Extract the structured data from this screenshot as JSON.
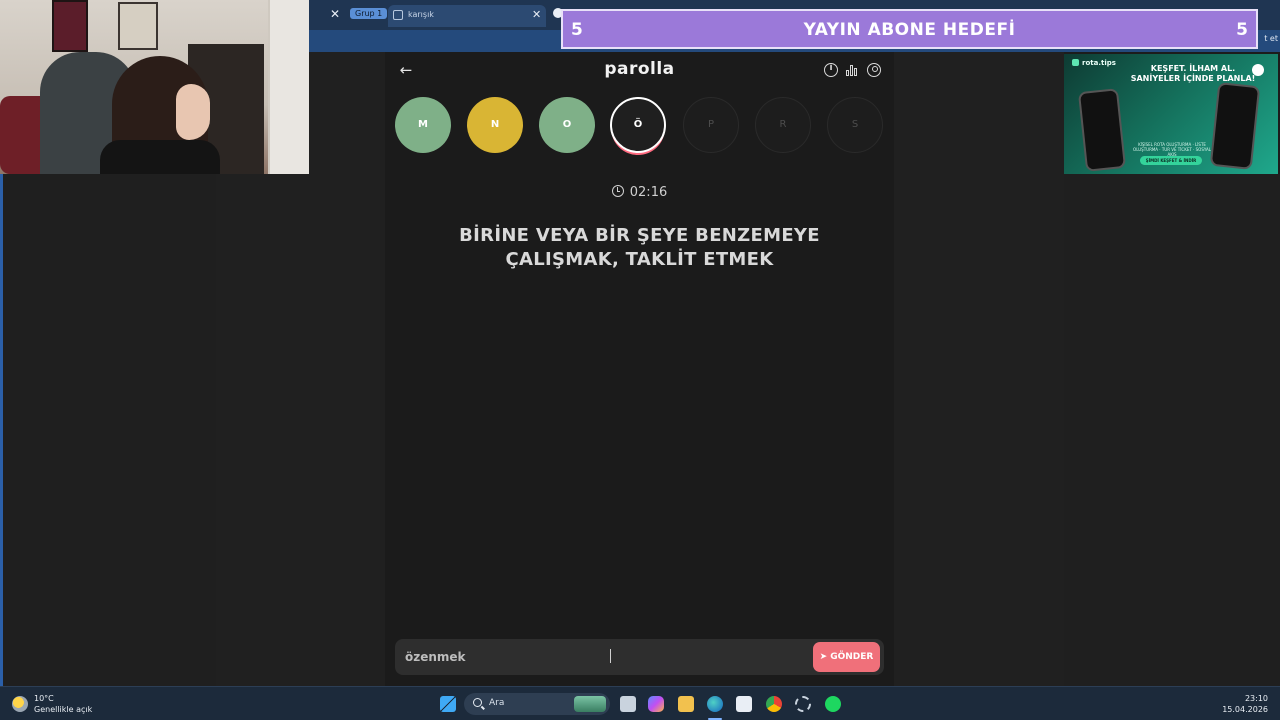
{
  "browser": {
    "tab_group": "Grup 1",
    "active_tab_title": "karışık",
    "address_right_fragment": "t et"
  },
  "goal_banner": {
    "left_count": "5",
    "title": "YAYIN ABONE HEDEFİ",
    "right_count": "5"
  },
  "ad": {
    "brand": "rota.tips",
    "headline_line1": "KEŞFET. İLHAM AL.",
    "headline_line2": "SANİYELER İÇİNDE PLANLA!",
    "subtext": "KİŞİSEL ROTA OLUŞTURMA · LİSTE OLUŞTURMA · TUR VE TİCKET · SOSYAL AKIŞ",
    "cta": "ŞİMDİ KEŞFET & İNDİR"
  },
  "game": {
    "title": "parolla",
    "back_icon": "arrow-left-icon",
    "header_icons": [
      "info-icon",
      "stats-icon",
      "user-icon"
    ],
    "letters": [
      {
        "letter": "M",
        "state": "correct"
      },
      {
        "letter": "N",
        "state": "passed"
      },
      {
        "letter": "O",
        "state": "correct"
      },
      {
        "letter": "Ö",
        "state": "current"
      },
      {
        "letter": "P",
        "state": "pending"
      },
      {
        "letter": "R",
        "state": "pending"
      },
      {
        "letter": "S",
        "state": "pending"
      }
    ],
    "timer": "02:16",
    "question": "BİRİNE VEYA BİR ŞEYE BENZEMEYE ÇALIŞMAK, TAKLİT ETMEK",
    "answer_value": "özenmek",
    "send_label": "GÖNDER",
    "colors": {
      "correct": "#7fb088",
      "passed": "#d9b534",
      "current_ring": "#ffffff",
      "send_button": "#f0707a"
    }
  },
  "taskbar": {
    "weather_temp": "10°C",
    "weather_desc": "Genellikle açık",
    "search_placeholder": "Ara",
    "time": "23:10",
    "date": "15.04.2026"
  }
}
